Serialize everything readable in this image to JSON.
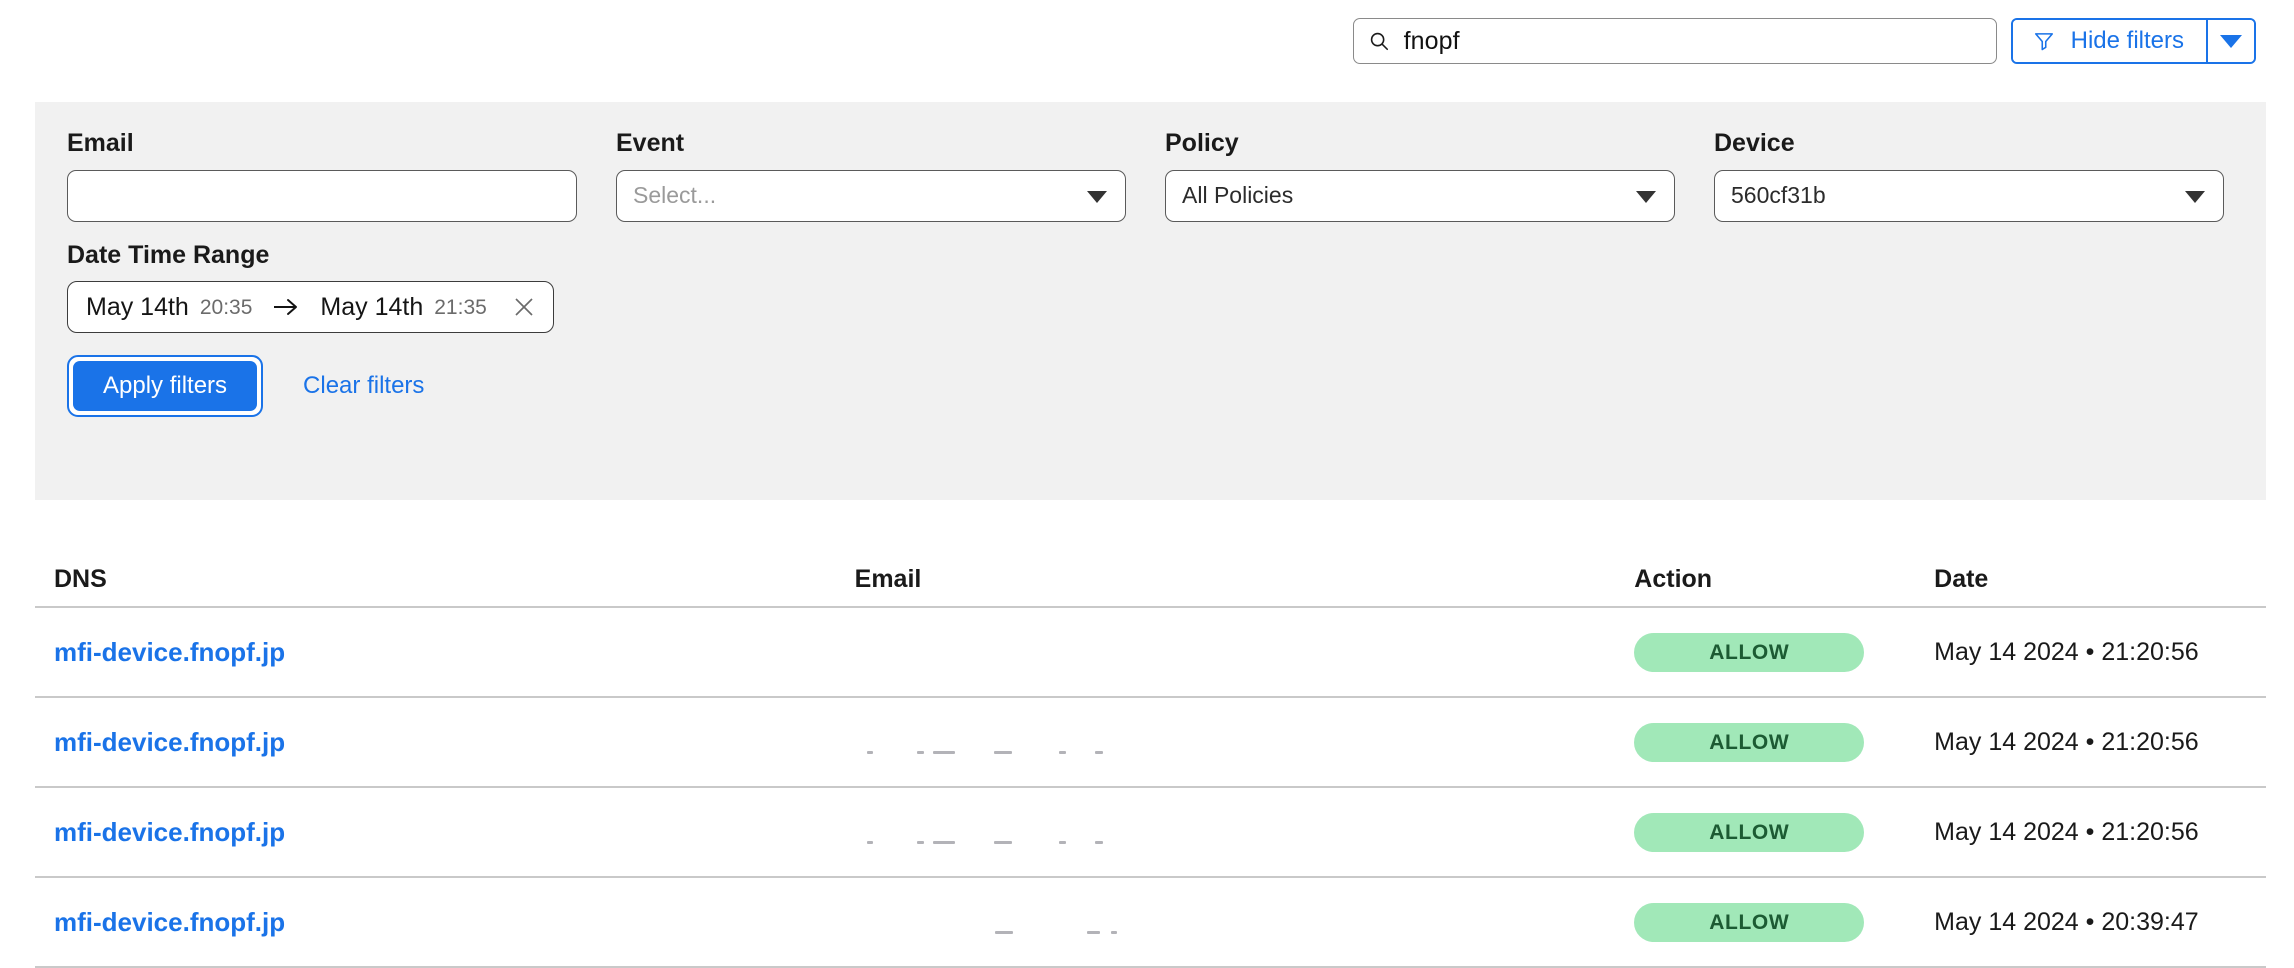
{
  "search": {
    "value": "fnopf",
    "placeholder": "Search",
    "icon": "search-icon"
  },
  "filters_toggle": {
    "label": "Hide filters",
    "icon": "funnel-icon",
    "caret_icon": "chevron-down-icon",
    "accent_color": "#1a73e8"
  },
  "filter_panel": {
    "background": "#f1f1f1",
    "fields": [
      {
        "label": "Email",
        "value": "",
        "placeholder": "",
        "type": "text",
        "name": "email"
      },
      {
        "label": "Event",
        "value": "Select...",
        "placeholder": "Select...",
        "type": "select",
        "name": "event"
      },
      {
        "label": "Policy",
        "value": "All Policies",
        "placeholder": "",
        "type": "select",
        "name": "policy"
      },
      {
        "label": "Device",
        "value": "560cf31b",
        "placeholder": "",
        "type": "select",
        "name": "device"
      }
    ],
    "date_range": {
      "label": "Date Time Range",
      "start_date": "May 14th",
      "start_time": "20:35",
      "arrow_icon": "arrow-right-icon",
      "end_date": "May 14th",
      "end_time": "21:35",
      "clear_icon": "close-icon"
    },
    "apply_label": "Apply filters",
    "clear_label": "Clear filters"
  },
  "table": {
    "columns": [
      "DNS",
      "Email",
      "Action",
      "Date"
    ],
    "rows": [
      {
        "dns": "mfi-device.fnopf.jp",
        "email": "",
        "action": "ALLOW",
        "date": "May 14 2024 • 21:20:56"
      },
      {
        "dns": "mfi-device.fnopf.jp",
        "email": "",
        "action": "ALLOW",
        "date": "May 14 2024 • 21:20:56"
      },
      {
        "dns": "mfi-device.fnopf.jp",
        "email": "",
        "action": "ALLOW",
        "date": "May 14 2024 • 21:20:56"
      },
      {
        "dns": "mfi-device.fnopf.jp",
        "email": "",
        "action": "ALLOW",
        "date": "May 14 2024 • 20:39:47"
      }
    ],
    "badge_colors": {
      "allow_bg": "#a1e8b8",
      "allow_text": "#1c5b33"
    }
  }
}
